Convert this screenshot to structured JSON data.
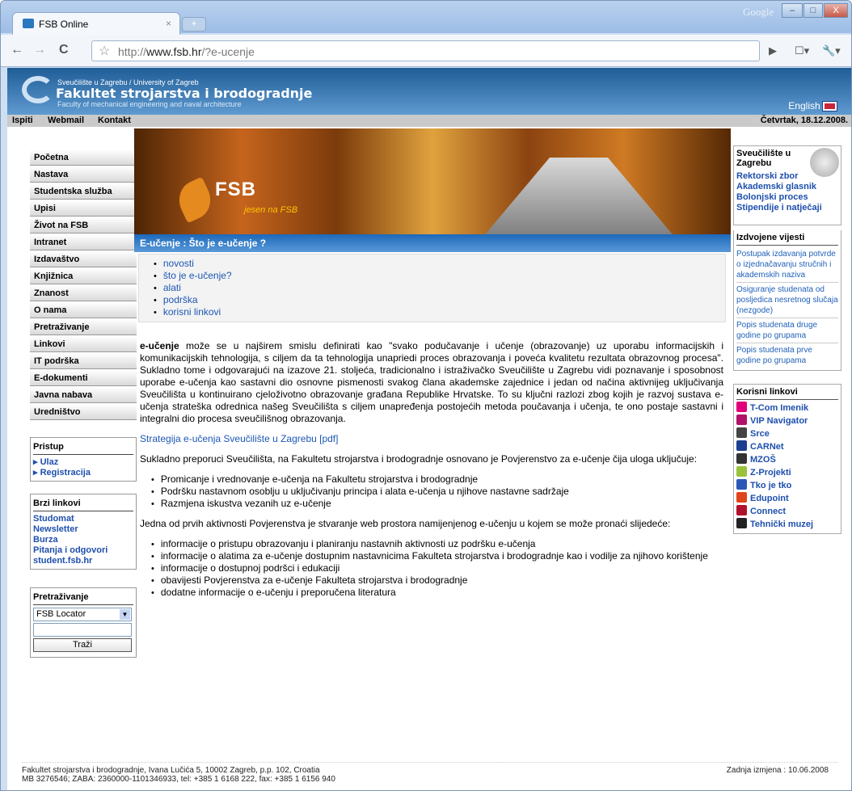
{
  "browser": {
    "tab_title": "FSB Online",
    "tab_close": "×",
    "new_tab": "+",
    "google": "Google",
    "url_plain": "http://",
    "url_host": "www.fsb.hr",
    "url_path": "/?e-ucenje",
    "back": "←",
    "forward": "→",
    "reload": "C",
    "star": "☆",
    "go": "▶",
    "page_menu": "☐▾",
    "tools_menu": "🔧▾",
    "window_controls": {
      "min": "–",
      "max": "□",
      "close": "X"
    }
  },
  "header": {
    "university": "Sveučilište u Zagrebu / University of Zagreb",
    "faculty": "Fakultet strojarstva i brodogradnje",
    "faculty_en": "Faculty of mechanical engineering and naval architecture",
    "english": "English",
    "logo": "FSB",
    "tagline": "jesen na FSB"
  },
  "topnav": [
    "Ispiti",
    "Webmail",
    "Kontakt"
  ],
  "date": "Četvrtak, 18.12.2008.",
  "leftnav": [
    "Početna",
    "Nastava",
    "Studentska služba",
    "Upisi",
    "Život na FSB",
    "Intranet",
    "Izdavaštvo",
    "Knjižnica",
    "Znanost",
    "O nama",
    "Pretraživanje",
    "Linkovi",
    "IT podrška",
    "E-dokumenti",
    "Javna nabava",
    "Uredništvo"
  ],
  "pristup": {
    "title": "Pristup",
    "items": [
      "▸ Ulaz",
      "▸ Registracija"
    ]
  },
  "brzi": {
    "title": "Brzi linkovi",
    "items": [
      "Studomat",
      "Newsletter",
      "Burza",
      "Pitanja i odgovori",
      "student.fsb.hr"
    ]
  },
  "search": {
    "title": "Pretraživanje",
    "select": "FSB Locator",
    "button": "Traži"
  },
  "page_title": "E-učenje : Što je e-učenje ?",
  "submenu": [
    "novosti",
    "što je e-učenje?",
    "alati",
    "podrška",
    "korisni linkovi"
  ],
  "content": {
    "intro_bold": "e-učenje",
    "intro": " može se u najširem smislu definirati kao \"svako podučavanje i učenje (obrazovanje) uz uporabu informacijskih i komunikacijskih tehnologija, s ciljem da ta tehnologija unapriedi proces obrazovanja i poveća kvalitetu rezultata obrazovnog procesa\". Sukladno tome i odgovarajući na izazove 21. stoljeća, tradicionalno i istraživačko Sveučilište u Zagrebu vidi poznavanje i sposobnost uporabe e-učenja kao sastavni dio osnovne pismenosti svakog člana akademske zajednice i jedan od načina aktivnijeg uključivanja Sveučilišta u kontinuirano cjeloživotno obrazovanje građana Republike Hrvatske. To su ključni razlozi zbog kojih je razvoj sustava e-učenja strateška odrednica našeg Sveučilišta s ciljem unapređenja postojećih metoda poučavanja i učenja, te ono postaje sastavni i integralni dio procesa sveučilišnog obrazovanja.",
    "strategy_link": "Strategija e-učenja Sveučilište u Zagrebu [pdf]",
    "p2": "Sukladno preporuci Sveučilišta, na Fakultetu strojarstva i brodogradnje osnovano je Povjerenstvo za e-učenje čija uloga uključuje:",
    "list1": [
      "Promicanje i vrednovanje e-učenja na Fakultetu strojarstva i brodogradnje",
      "Podršku nastavnom osoblju u uključivanju principa i alata e-učenja u njihove nastavne sadržaje",
      "Razmjena iskustva vezanih uz e-učenje"
    ],
    "p3": "Jedna od prvih aktivnosti Povjerenstva je stvaranje web prostora namijenjenog e-učenju u kojem se može pronaći slijedeće:",
    "list2": [
      "informacije o pristupu obrazovanju i planiranju nastavnih aktivnosti uz podršku e-učenja",
      "informacije o alatima za e-učenje dostupnim nastavnicima Fakulteta strojarstva i brodogradnje kao i vodilje za njihovo korištenje",
      "informacije o dostupnoj podršci i edukaciji",
      "obavijesti Povjerenstva za e-učenje Fakulteta strojarstva i brodogradnje",
      "dodatne informacije o e-učenju i preporučena literatura"
    ]
  },
  "right": {
    "uni_title": "Sveučilište u Zagrebu",
    "uni_links": [
      "Rektorski zbor",
      "Akademski glasnik",
      "Bolonjski proces",
      "Stipendije i natječaji"
    ],
    "news_title": "Izdvojene vijesti",
    "news": [
      "Postupak izdavanja potvrde o izjednačavanju stručnih i akademskih naziva",
      "Osiguranje studenata od posljedica nesretnog slučaja (nezgode)",
      "Popis studenata druge godine po grupama",
      "Popis studenata prve godine po grupama"
    ],
    "links_title": "Korisni linkovi",
    "links": [
      {
        "label": "T-Com Imenik",
        "color": "#e2007a"
      },
      {
        "label": "VIP Navigator",
        "color": "#b0126a"
      },
      {
        "label": "Srce",
        "color": "#444444"
      },
      {
        "label": "CARNet",
        "color": "#1d3f8f"
      },
      {
        "label": "MZOŠ",
        "color": "#333333"
      },
      {
        "label": "Z-Projekti",
        "color": "#9ac23c"
      },
      {
        "label": "Tko je tko",
        "color": "#2b58b6"
      },
      {
        "label": "Edupoint",
        "color": "#e0441a"
      },
      {
        "label": "Connect",
        "color": "#b0122d"
      },
      {
        "label": "Tehnički muzej",
        "color": "#222222"
      }
    ]
  },
  "footer": {
    "line1": "Fakultet strojarstva i brodogradnje, Ivana Lučića 5, 10002 Zagreb, p.p. 102, Croatia",
    "line2": "MB 3276546; ZABA: 2360000-1101346933, tel: +385 1 6168 222, fax: +385 1 6156 940",
    "modified": "Zadnja izmjena : 10.06.2008"
  }
}
